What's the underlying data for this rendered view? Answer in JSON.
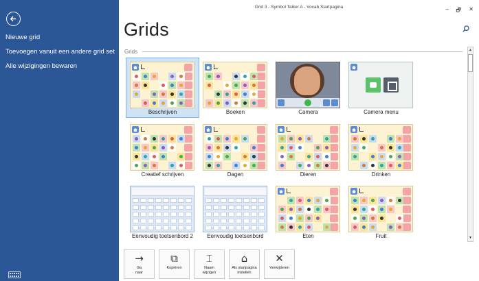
{
  "window": {
    "title": "Grid 3 - Symbol Talker A - Vocab Startpagina",
    "minimize": "–",
    "restore": "🗗",
    "close": "✕"
  },
  "sidebar": {
    "items": [
      {
        "label": "Nieuwe grid"
      },
      {
        "label": "Toevoegen vanuit een andere grid set"
      },
      {
        "label": "Alle wijzigingen bewaren"
      }
    ]
  },
  "header": {
    "title": "Grids",
    "section": "Grids"
  },
  "grids": [
    {
      "label": "Beschrijven",
      "kind": "symbols",
      "selected": true
    },
    {
      "label": "Boeken",
      "kind": "symbols"
    },
    {
      "label": "Camera",
      "kind": "camera"
    },
    {
      "label": "Camera menu",
      "kind": "cammenu"
    },
    {
      "label": "Creatief schrijven",
      "kind": "symbols"
    },
    {
      "label": "Dagen",
      "kind": "symbols"
    },
    {
      "label": "Dieren",
      "kind": "symbols"
    },
    {
      "label": "Drinken",
      "kind": "symbols"
    },
    {
      "label": "Eenvoudig toetsenbord 2",
      "kind": "keyboard"
    },
    {
      "label": "Eenvoudig toetsenbord",
      "kind": "keyboard"
    },
    {
      "label": "Eten",
      "kind": "symbols"
    },
    {
      "label": "Fruit",
      "kind": "symbols"
    }
  ],
  "toolbar": {
    "buttons": [
      {
        "label": "Ga\nnaar",
        "icon": "→"
      },
      {
        "label": "Kopiëren",
        "icon": "⧉"
      },
      {
        "label": "Naam\nwijzigen",
        "icon": "⌶"
      },
      {
        "label": "Als startpagina\ninstellen",
        "icon": "⌂"
      },
      {
        "label": "Verwijderen",
        "icon": "✕"
      }
    ]
  },
  "colors": {
    "sidebar": "#2b5797",
    "selection": "#cfe3f7",
    "thumb_bg": "#fdf3d2"
  }
}
